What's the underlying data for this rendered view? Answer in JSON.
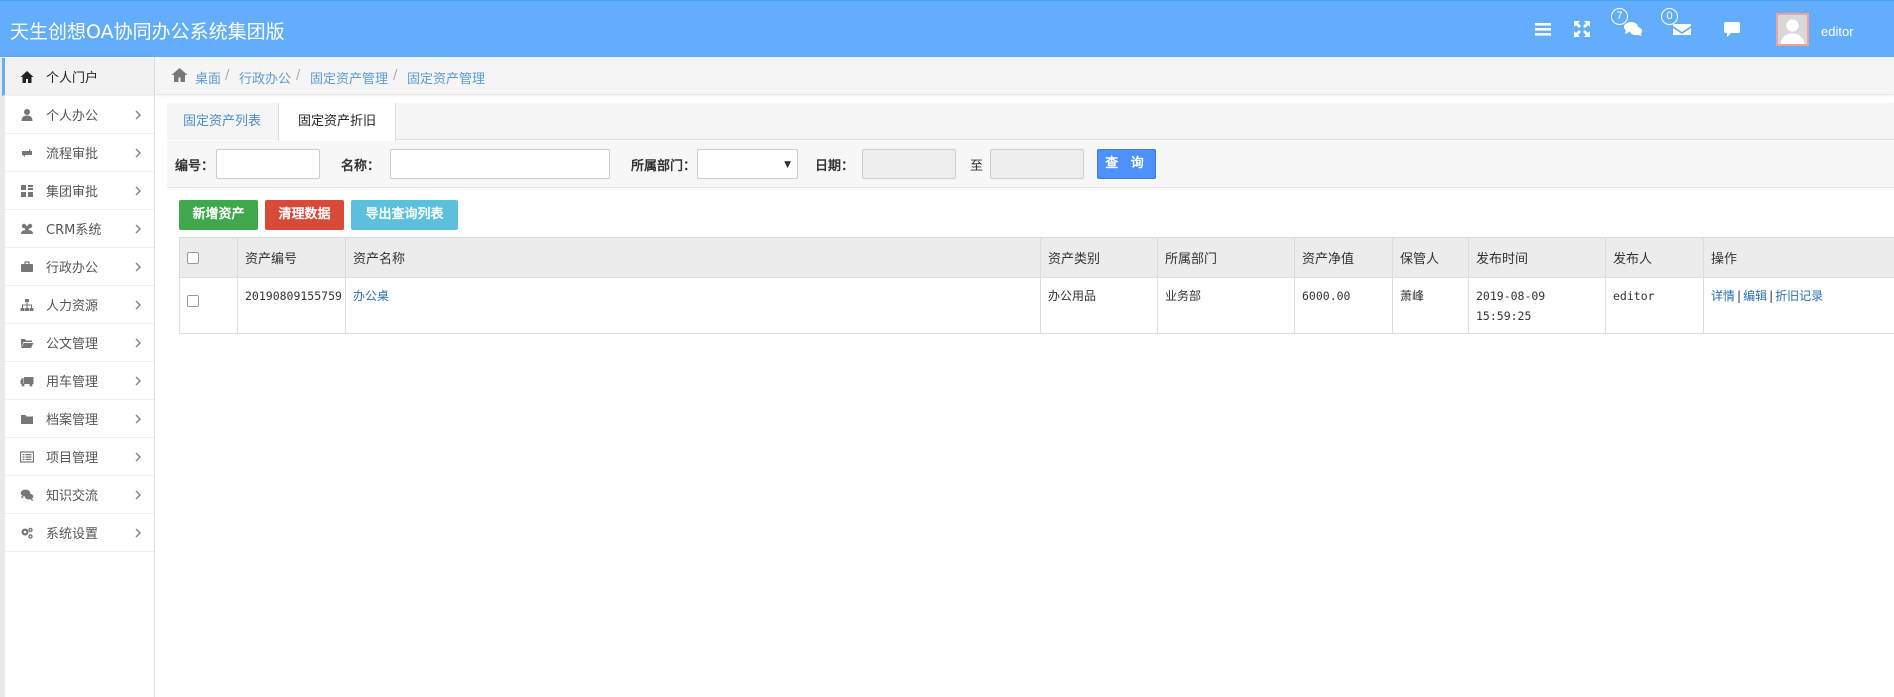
{
  "header": {
    "title": "天生创想OA协同办公系统集团版",
    "messages_badge": "7",
    "mail_badge": "0",
    "username": "editor"
  },
  "sidebar": {
    "items": [
      {
        "label": "个人门户",
        "icon": "home-icon"
      },
      {
        "label": "个人办公",
        "icon": "user-icon"
      },
      {
        "label": "流程审批",
        "icon": "retweet-icon"
      },
      {
        "label": "集团审批",
        "icon": "grid-icon"
      },
      {
        "label": "CRM系统",
        "icon": "users-icon"
      },
      {
        "label": "行政办公",
        "icon": "briefcase-icon"
      },
      {
        "label": "人力资源",
        "icon": "sitemap-icon"
      },
      {
        "label": "公文管理",
        "icon": "folder-open-icon"
      },
      {
        "label": "用车管理",
        "icon": "truck-icon"
      },
      {
        "label": "档案管理",
        "icon": "folder-icon"
      },
      {
        "label": "项目管理",
        "icon": "list-alt-icon"
      },
      {
        "label": "知识交流",
        "icon": "comments-icon"
      },
      {
        "label": "系统设置",
        "icon": "cogs-icon"
      }
    ]
  },
  "breadcrumb": [
    "桌面",
    "行政办公",
    "固定资产管理",
    "固定资产管理"
  ],
  "tabs": [
    "固定资产列表",
    "固定资产折旧"
  ],
  "search": {
    "code_label": "编号：",
    "name_label": "名称：",
    "dept_label": "所属部门：",
    "date_label": "日期：",
    "to_label": "至",
    "query_button": "查 询"
  },
  "actions": {
    "add": "新增资产",
    "clear": "清理数据",
    "export": "导出查询列表"
  },
  "table": {
    "headers": [
      "资产编号",
      "资产名称",
      "资产类别",
      "所属部门",
      "资产净值",
      "保管人",
      "发布时间",
      "发布人",
      "操作"
    ],
    "rows": [
      {
        "code": "20190809155759",
        "name": "办公桌",
        "category": "办公用品",
        "dept": "业务部",
        "value": "6000.00",
        "keeper": "萧峰",
        "date": "2019-08-09",
        "time": "15:59:25",
        "publisher": "editor",
        "op_detail": "详情",
        "op_edit": "编辑",
        "op_depr": "折旧记录"
      }
    ]
  },
  "colors": {
    "header_bg": "#62aefd",
    "link": "#2a6fb5",
    "green": "#3ea84b",
    "red": "#d84a38",
    "cyan": "#5bc0de",
    "query": "#4d90fe"
  }
}
